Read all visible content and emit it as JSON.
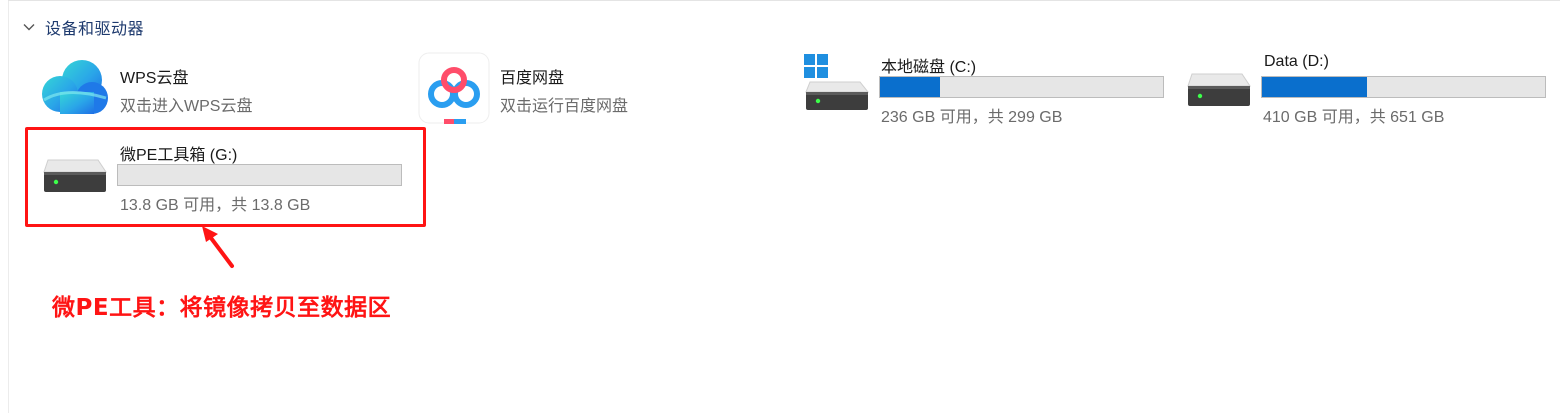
{
  "section": {
    "title": "设备和驱动器",
    "icon": "chevron-down-icon"
  },
  "cloud_items": [
    {
      "name": "WPS云盘",
      "subtitle": "双击进入WPS云盘",
      "icon": "wps-cloud-icon"
    },
    {
      "name": "百度网盘",
      "subtitle": "双击运行百度网盘",
      "icon": "baidu-netdisk-icon"
    }
  ],
  "drives": [
    {
      "name": "本地磁盘 (C:)",
      "usage": "236 GB 可用，共 299 GB",
      "used_fraction": 0.211,
      "bar_color": "#0a6fcd",
      "icon": "system-drive-icon"
    },
    {
      "name": "Data (D:)",
      "usage": "410 GB 可用，共 651 GB",
      "used_fraction": 0.37,
      "bar_color": "#0a6fcd",
      "icon": "hard-drive-icon"
    },
    {
      "name": "微PE工具箱 (G:)",
      "usage": "13.8 GB 可用，共 13.8 GB",
      "used_fraction": 0.0,
      "bar_color": "#0a6fcd",
      "icon": "hard-drive-icon"
    }
  ],
  "annotation": {
    "text": "微PE工具：将镜像拷贝至数据区",
    "color": "#ff1414"
  }
}
